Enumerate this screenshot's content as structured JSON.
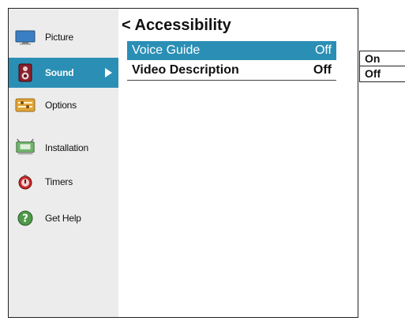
{
  "sidebar": {
    "items": [
      {
        "label": "Picture",
        "icon": "picture-icon"
      },
      {
        "label": "Sound",
        "icon": "speaker-icon",
        "selected": true
      },
      {
        "label": "Options",
        "icon": "options-icon"
      },
      {
        "label": "Installation",
        "icon": "installation-icon"
      },
      {
        "label": "Timers",
        "icon": "timer-icon"
      },
      {
        "label": "Get Help",
        "icon": "help-icon"
      }
    ]
  },
  "main": {
    "title": "< Accessibility",
    "rows": [
      {
        "label": "Voice Guide",
        "value": "Off",
        "selected": true
      },
      {
        "label": "Video Description",
        "value": "Off",
        "selected": false
      }
    ]
  },
  "popup": {
    "options": [
      "On",
      "Off"
    ]
  },
  "colors": {
    "accent": "#2b8fb5",
    "sidebar_bg": "#ececec"
  }
}
